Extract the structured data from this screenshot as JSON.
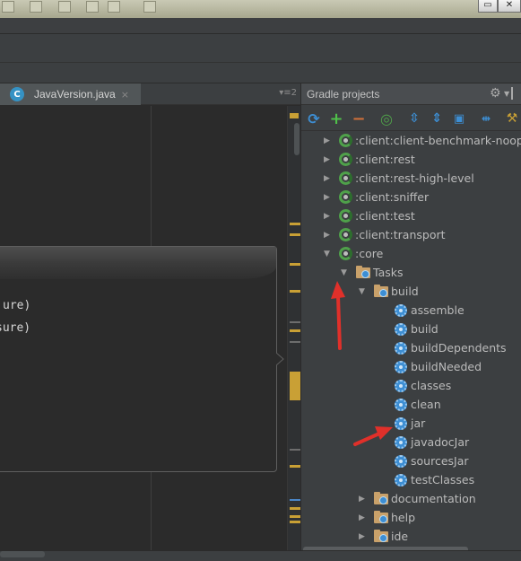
{
  "editor": {
    "tab_icon": "C",
    "tab_title": "JavaVersion.java",
    "tab_close": "×",
    "tab_menu": "▾≡2",
    "popup_lines": [
      "ure)",
      "sure)"
    ]
  },
  "gradle": {
    "title": "Gradle projects",
    "toolbar_icons": [
      "refresh-icon",
      "add-icon",
      "remove-icon",
      "execute-task-icon",
      "expand-all-icon",
      "collapse-all-icon",
      "attach-project-icon",
      "toggle-offline-icon",
      "settings-icon"
    ],
    "tree": [
      {
        "label": ":client:client-benchmark-noop-a",
        "type": "project",
        "expanded": false
      },
      {
        "label": ":client:rest",
        "type": "project",
        "expanded": false
      },
      {
        "label": ":client:rest-high-level",
        "type": "project",
        "expanded": false
      },
      {
        "label": ":client:sniffer",
        "type": "project",
        "expanded": false
      },
      {
        "label": ":client:test",
        "type": "project",
        "expanded": false
      },
      {
        "label": ":client:transport",
        "type": "project",
        "expanded": false
      },
      {
        "label": ":core",
        "type": "project",
        "expanded": true
      },
      {
        "label": "Tasks",
        "type": "folder",
        "expanded": true
      },
      {
        "label": "build",
        "type": "folder",
        "expanded": true
      },
      {
        "label": "assemble",
        "type": "task"
      },
      {
        "label": "build",
        "type": "task"
      },
      {
        "label": "buildDependents",
        "type": "task"
      },
      {
        "label": "buildNeeded",
        "type": "task"
      },
      {
        "label": "classes",
        "type": "task"
      },
      {
        "label": "clean",
        "type": "task"
      },
      {
        "label": "jar",
        "type": "task"
      },
      {
        "label": "javadocJar",
        "type": "task"
      },
      {
        "label": "sourcesJar",
        "type": "task"
      },
      {
        "label": "testClasses",
        "type": "task"
      },
      {
        "label": "documentation",
        "type": "folder",
        "expanded": false
      },
      {
        "label": "help",
        "type": "folder",
        "expanded": false
      },
      {
        "label": "ide",
        "type": "folder",
        "expanded": false
      }
    ]
  },
  "colors": {
    "annotation_arrow": "#e0302a",
    "stripe_warning": "#c9a035"
  }
}
